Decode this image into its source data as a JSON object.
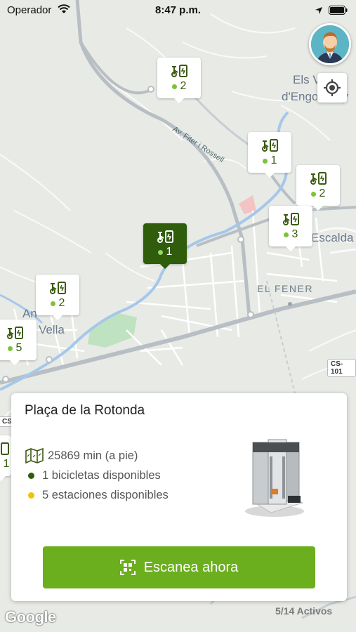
{
  "status_bar": {
    "carrier": "Operador",
    "time": "8:47 p.m."
  },
  "map": {
    "labels": {
      "els_v": "Els V",
      "engordany": "d'Engordany",
      "escaldes": "Escalda",
      "el_fener": "EL FENER",
      "andorra": "An",
      "vella": "Vella"
    },
    "road_labels": {
      "fiteri": "Av. Fiter i Rossell"
    },
    "shields": {
      "cs101": "CS-101",
      "cs": "CS"
    },
    "markers": [
      {
        "count": "2",
        "active": false
      },
      {
        "count": "1",
        "active": false
      },
      {
        "count": "2",
        "active": false
      },
      {
        "count": "3",
        "active": false
      },
      {
        "count": "1",
        "active": true
      },
      {
        "count": "2",
        "active": false
      },
      {
        "count": "5",
        "active": false
      },
      {
        "count": "1",
        "active": false
      }
    ]
  },
  "station_card": {
    "name": "Plaça de la Rotonda",
    "distance": "25869 min (a pie)",
    "bikes": "1 bicicletas disponibles",
    "stations": "5 estaciones disponibles",
    "scan_label": "Escanea ahora"
  },
  "footer": {
    "google": "Google",
    "active_count": "5/14 Activos"
  },
  "colors": {
    "primary": "#6bae1e",
    "dark_green": "#2f5d0c",
    "bike_dot": "#2f5d0c",
    "station_dot": "#f2c200",
    "marker_dot": "#7cc33a"
  },
  "icons": [
    "wifi-icon",
    "location-arrow-icon",
    "battery-icon",
    "avatar",
    "locate-icon",
    "bike-station-icon",
    "map-icon",
    "qr-scan-icon",
    "charging-station-image"
  ]
}
